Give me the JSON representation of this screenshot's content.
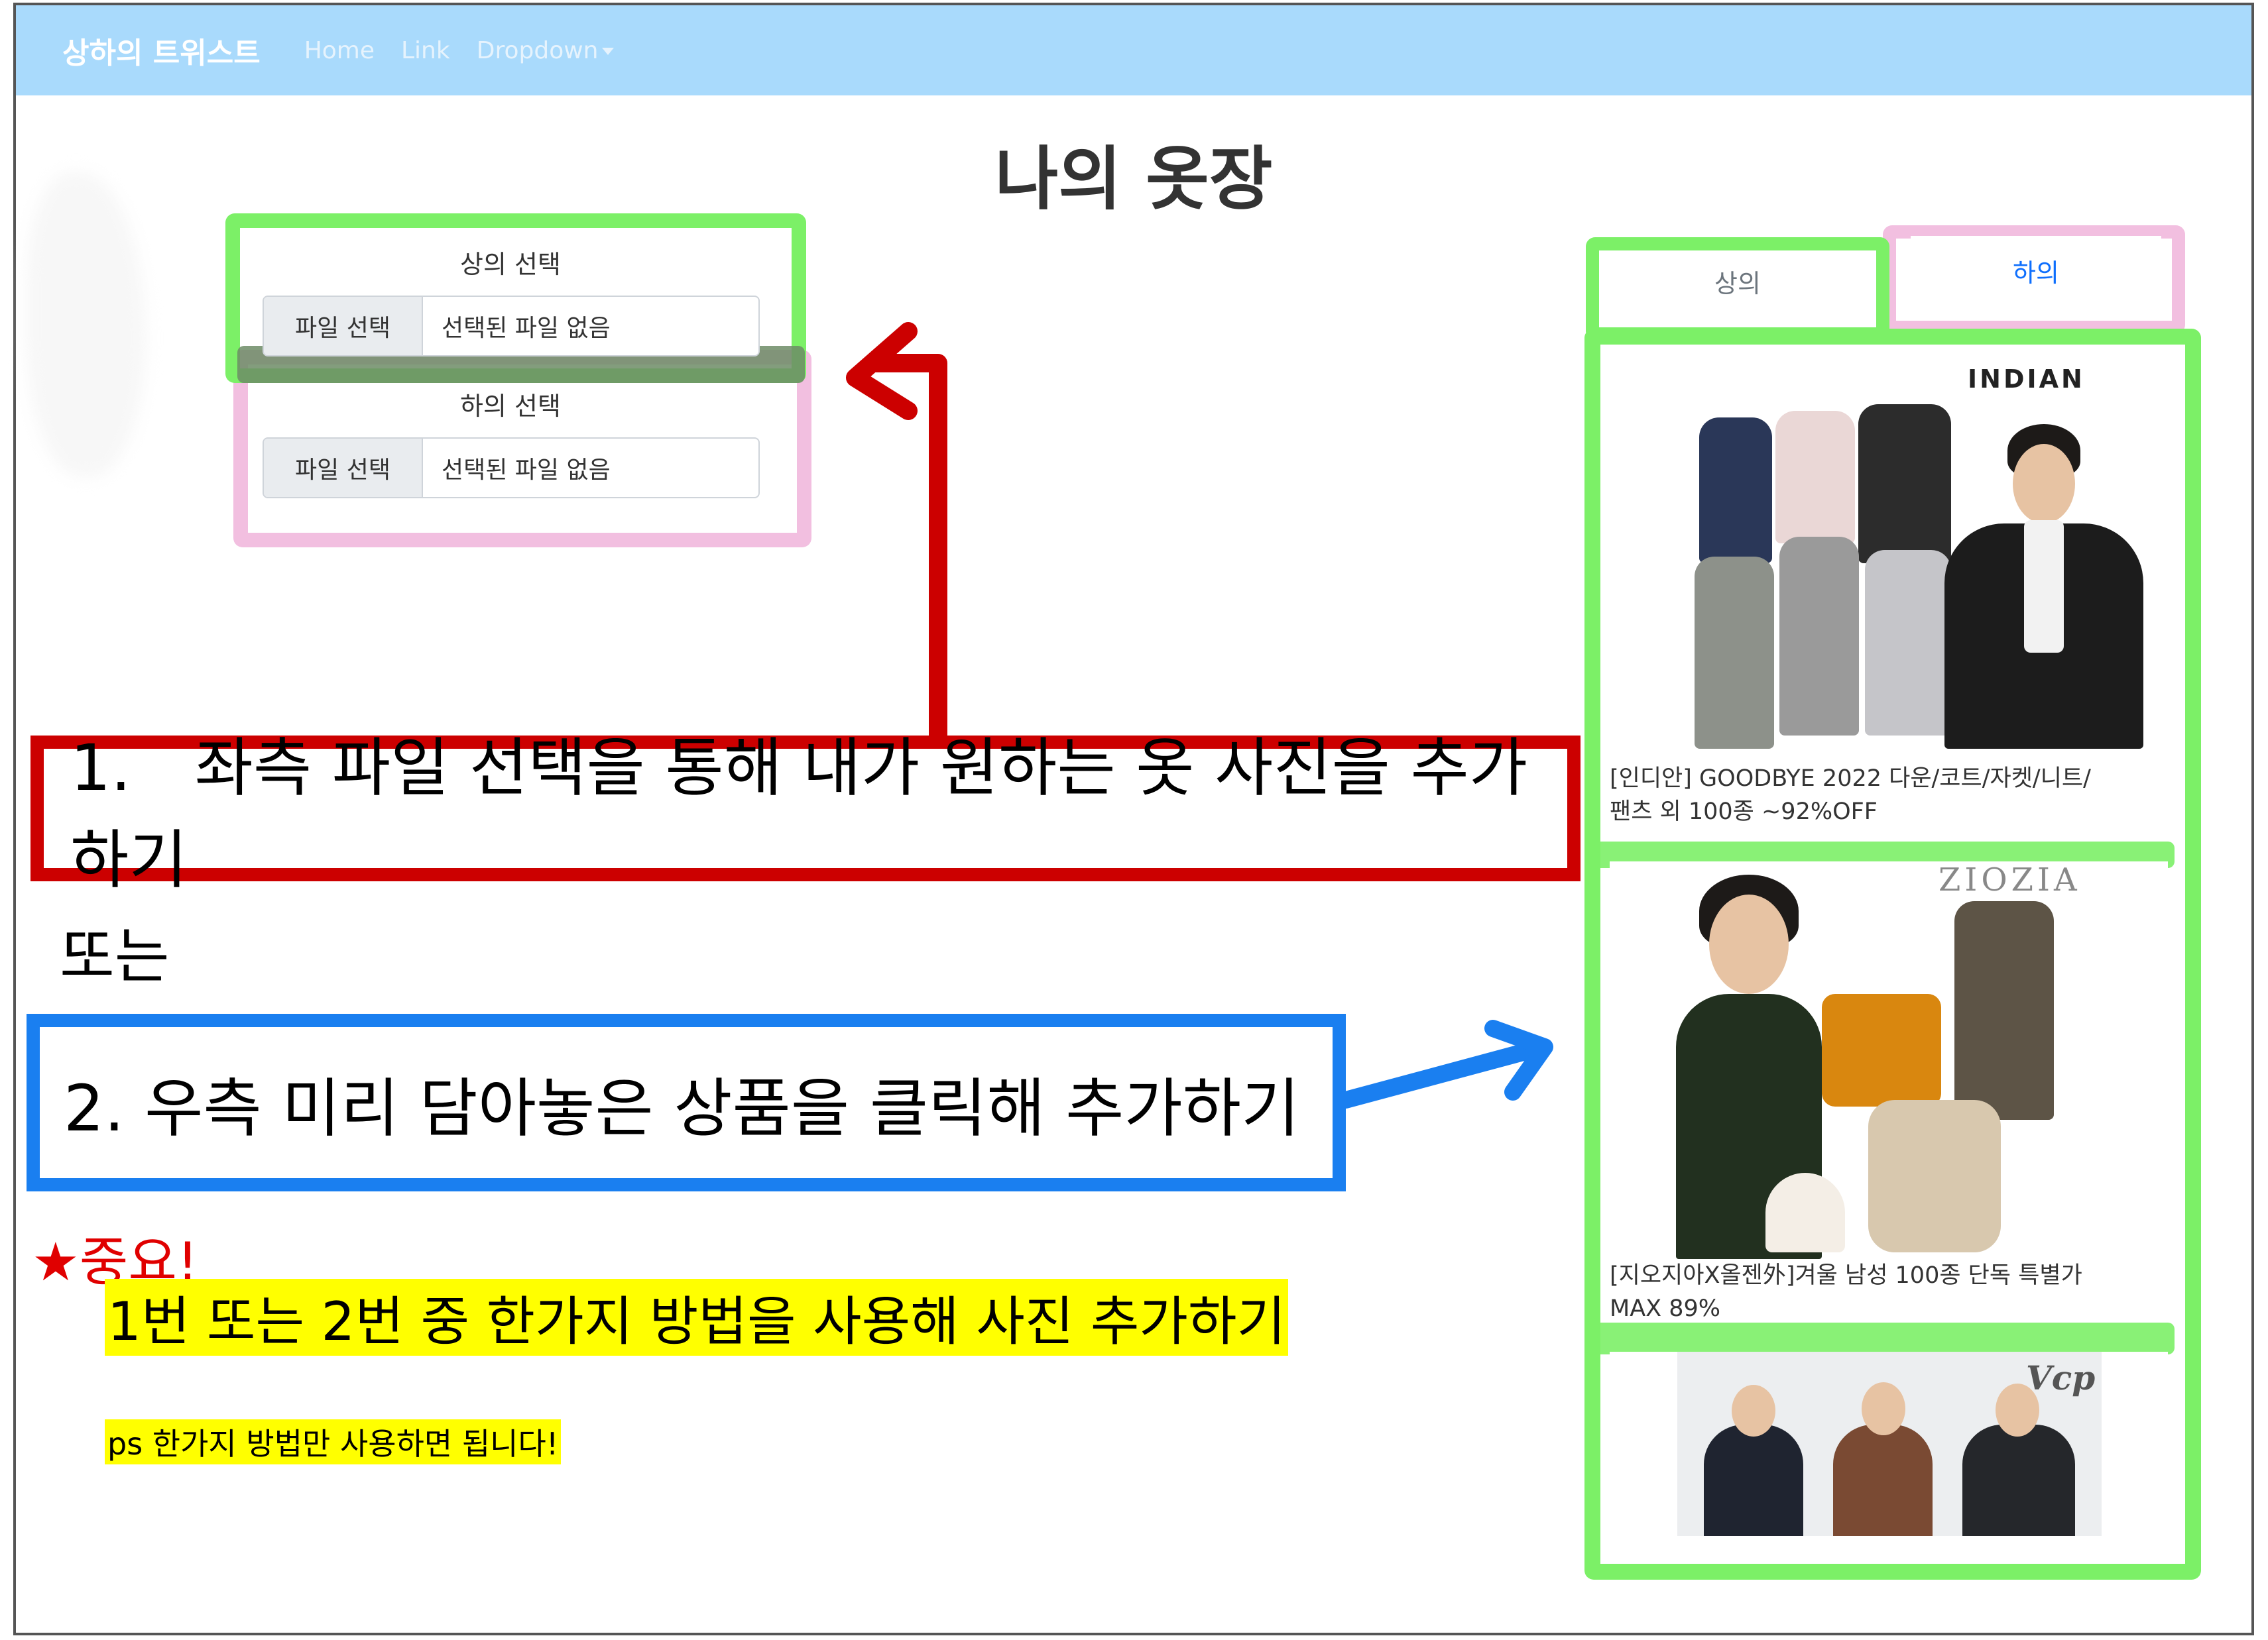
{
  "navbar": {
    "brand": "상하의 트위스트",
    "links": [
      "Home",
      "Link",
      "Dropdown"
    ]
  },
  "page": {
    "title": "나의 옷장"
  },
  "upload": {
    "top": {
      "label": "상의 선택",
      "button": "파일 선택",
      "status": "선택된 파일 없음"
    },
    "bottom": {
      "label": "하의 선택",
      "button": "파일 선택",
      "status": "선택된 파일 없음"
    }
  },
  "instructions": {
    "step1": "1.　좌측 파일 선택을 통해 내가 원하는 옷 사진을 추가하기",
    "or": "또는",
    "step2": "2. 우측 미리 담아놓은 상품을 클릭해 추가하기",
    "important": "★중요!",
    "note": "1번 또는 2번 중 한가지 방법을 사용해 사진 추가하기",
    "ps": "ps 한가지 방법만 사용하면 됩니다!"
  },
  "tabs": {
    "top": "상의",
    "bottom": "하의"
  },
  "products": [
    {
      "brand": "INDIAN",
      "caption_line1": "[인디안] GOODBYE 2022 다운/코트/자켓/니트/",
      "caption_line2": "팬츠 외 100종 ~92%OFF"
    },
    {
      "brand": "ZIOZIA",
      "caption_line1": "[지오지아X올젠外]겨울 남성 100종 단독 특별가",
      "caption_line2": "MAX 89%"
    },
    {
      "brand": "Vcp"
    }
  ],
  "colors": {
    "navbar": "#a9dafc",
    "highlight_green": "#7cf067",
    "highlight_pink": "#f2bfe0",
    "box_red": "#cc0000",
    "box_blue": "#1a7ff0",
    "marker_yellow": "#ffff00",
    "important_red": "#e00000"
  }
}
